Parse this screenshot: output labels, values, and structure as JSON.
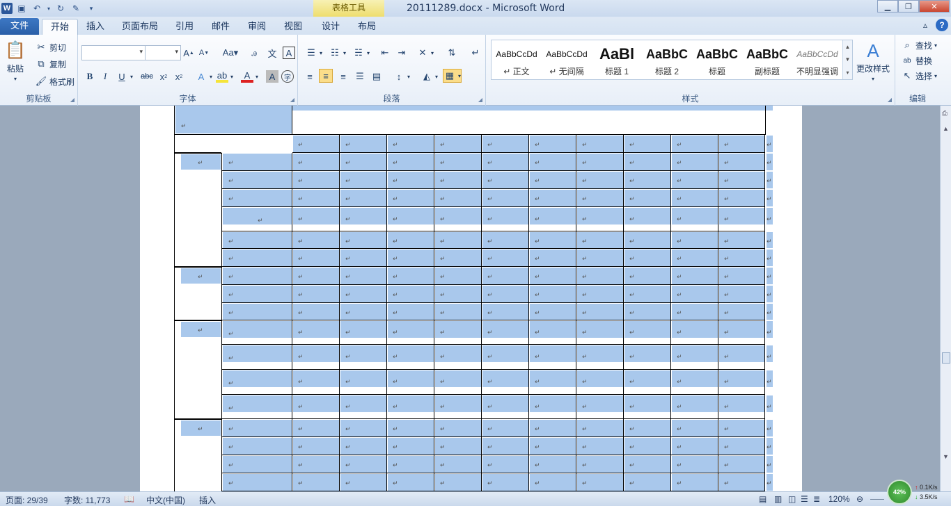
{
  "title": {
    "document": "20111289.docx - Microsoft Word",
    "context_tab_group": "表格工具"
  },
  "tabs": [
    {
      "label": "文件"
    },
    {
      "label": "开始"
    },
    {
      "label": "插入"
    },
    {
      "label": "页面布局"
    },
    {
      "label": "引用"
    },
    {
      "label": "邮件"
    },
    {
      "label": "审阅"
    },
    {
      "label": "视图"
    },
    {
      "label": "设计"
    },
    {
      "label": "布局"
    }
  ],
  "clipboard": {
    "paste": "粘贴",
    "cut": "剪切",
    "copy": "复制",
    "format_painter": "格式刷",
    "label": "剪贴板"
  },
  "font": {
    "label": "字体",
    "font_name": "",
    "font_size": ""
  },
  "paragraph": {
    "label": "段落"
  },
  "styles": {
    "label": "样式",
    "items": [
      {
        "sample": "AaBbCcDd",
        "name": "↵ 正文"
      },
      {
        "sample": "AaBbCcDd",
        "name": "↵ 无间隔"
      },
      {
        "sample": "AaBl",
        "name": "标题 1"
      },
      {
        "sample": "AaBbC",
        "name": "标题 2"
      },
      {
        "sample": "AaBbC",
        "name": "标题"
      },
      {
        "sample": "AaBbC",
        "name": "副标题"
      },
      {
        "sample": "AaBbCcDd",
        "name": "不明显强调"
      }
    ],
    "change_styles": "更改样式"
  },
  "editing": {
    "label": "编辑",
    "find": "查找",
    "replace": "替换",
    "select": "选择"
  },
  "status": {
    "page": "页面: 29/39",
    "words": "字数: 11,773",
    "language": "中文(中国)",
    "mode": "插入",
    "zoom": "120%",
    "net_percent": "42%",
    "net_up": "0.1K/s",
    "net_down": "3.5K/s"
  },
  "colors": {
    "accent": "#2b579a",
    "cell_highlight": "#a9c8ec",
    "context_tab": "#eedd6e"
  },
  "table": {
    "paragraph_mark": "↵"
  }
}
